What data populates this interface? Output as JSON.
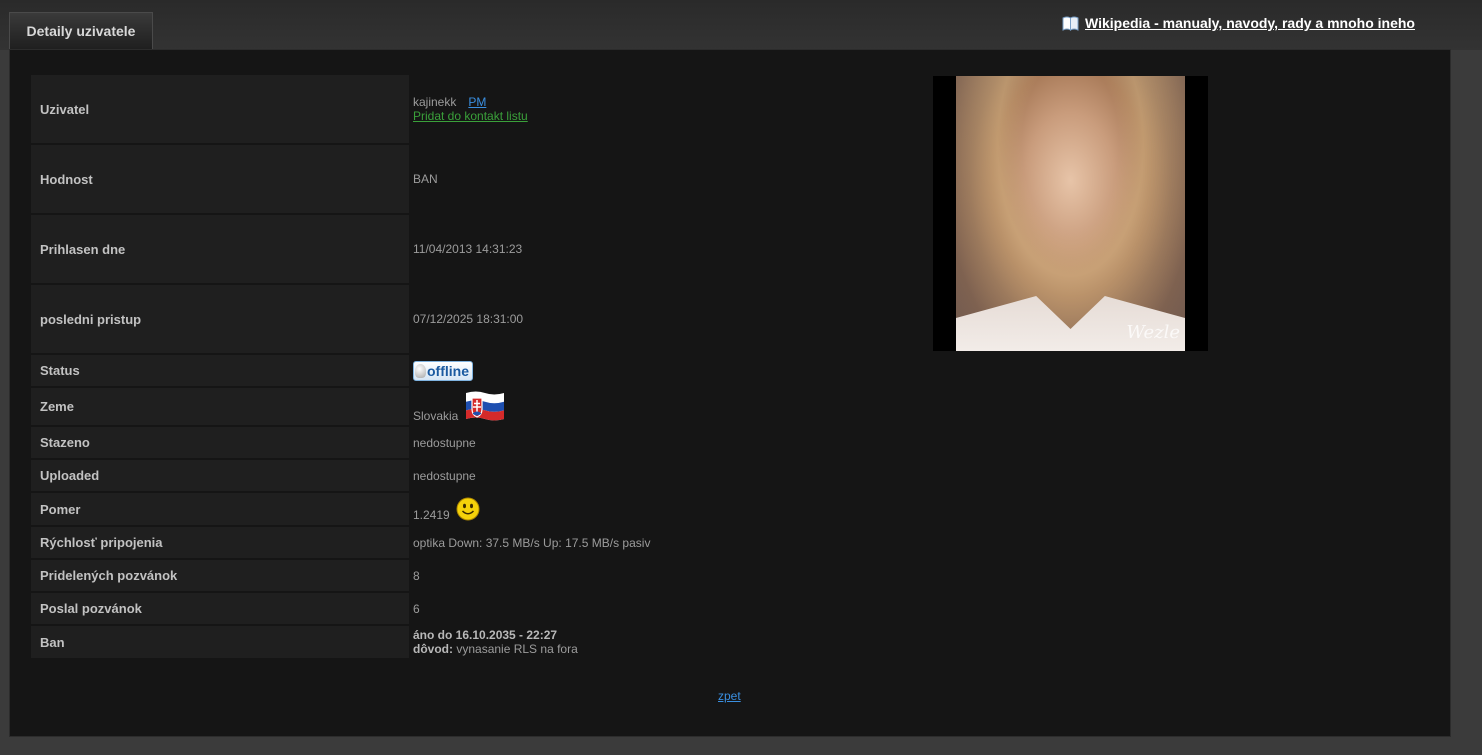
{
  "tab": {
    "title": "Detaily uzivatele"
  },
  "header": {
    "wiki_link": "Wikipedia - manualy, navody, rady a mnoho ineho"
  },
  "labels": {
    "user": "Uzivatel",
    "rank": "Hodnost",
    "registered": "Prihlasen dne",
    "last_access": "posledni pristup",
    "status": "Status",
    "country": "Zeme",
    "downloaded": "Stazeno",
    "uploaded": "Uploaded",
    "ratio": "Pomer",
    "speed": "Rýchlosť pripojenia",
    "invites_given": "Pridelených pozvánok",
    "invites_sent": "Poslal pozvánok",
    "ban": "Ban"
  },
  "values": {
    "username": "kajinekk",
    "pm_link": "PM",
    "add_contact": "Pridat do kontakt listu",
    "rank": "BAN",
    "registered": "11/04/2013 14:31:23",
    "last_access": "07/12/2025 18:31:00",
    "status_badge": "offline",
    "country": "Slovakia",
    "downloaded": "nedostupne",
    "uploaded": "nedostupne",
    "ratio": "1.2419",
    "speed": "optika Down: 37.5 MB/s Up: 17.5 MB/s pasiv",
    "invites_given": "8",
    "invites_sent": "6",
    "ban_until_label": "áno do 16.10.2035 - 22:27",
    "ban_reason_label": "dôvod:",
    "ban_reason": "vynasanie RLS na fora"
  },
  "avatar": {
    "watermark": "Wezle"
  },
  "footer": {
    "back_link": "zpet"
  },
  "icons": [
    "book-icon",
    "bulb-icon",
    "flag-slovakia-icon",
    "smiley-icon"
  ],
  "colors": {
    "link_blue": "#3a8fe0",
    "link_green": "#3aa03a",
    "panel_bg": "#151515"
  }
}
